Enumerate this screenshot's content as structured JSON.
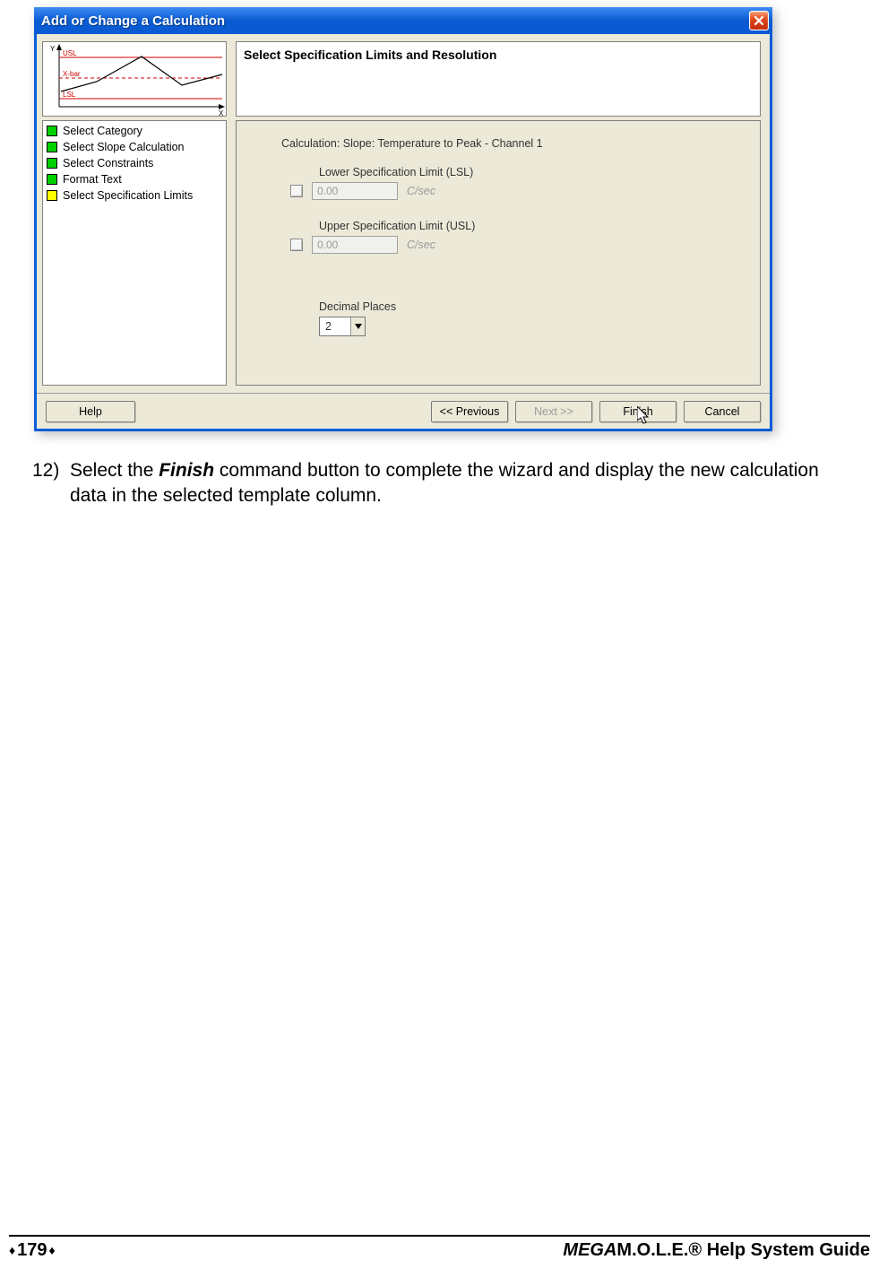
{
  "dialog": {
    "title": "Add or Change a Calculation",
    "graph": {
      "y_label": "Y",
      "x_label": "X",
      "usl": "USL",
      "xbar": "X-bar",
      "lsl": "LSL"
    },
    "steps": [
      {
        "label": "Select Category",
        "color": "green"
      },
      {
        "label": "Select Slope Calculation",
        "color": "green"
      },
      {
        "label": "Select Constraints",
        "color": "green"
      },
      {
        "label": "Format Text",
        "color": "green"
      },
      {
        "label": "Select Specification Limits",
        "color": "yellow"
      }
    ],
    "header": "Select Specification Limits and Resolution",
    "calculation_label": "Calculation: Slope: Temperature to Peak - Channel 1",
    "lsl": {
      "label": "Lower Specification Limit (LSL)",
      "value": "0.00",
      "unit": "C/sec"
    },
    "usl": {
      "label": "Upper Specification Limit (USL)",
      "value": "0.00",
      "unit": "C/sec"
    },
    "decimal": {
      "label": "Decimal Places",
      "value": "2"
    },
    "buttons": {
      "help": "Help",
      "prev": "<< Previous",
      "next": "Next >>",
      "finish": "Finish",
      "cancel": "Cancel"
    }
  },
  "instruction": {
    "number": "12)",
    "before": "Select the ",
    "bold": "Finish",
    "after": " command button to complete the wizard and display the new calculation data in the selected template column."
  },
  "footer": {
    "page": "179",
    "brand_italic": "MEGA",
    "brand_rest": "M.O.L.E.® Help System Guide"
  }
}
